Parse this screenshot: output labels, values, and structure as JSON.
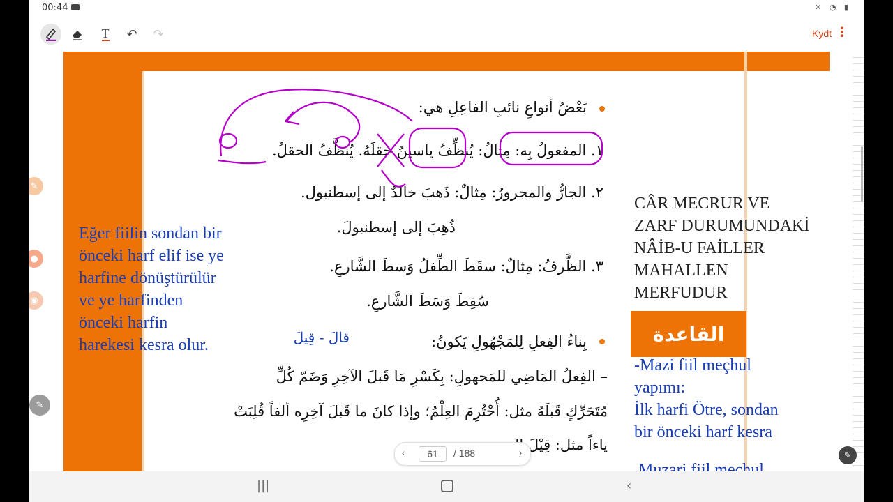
{
  "status": {
    "time": "00:44"
  },
  "toolbar": {
    "pen_icon": "pen-icon",
    "eraser_icon": "eraser-icon",
    "text_icon": "T",
    "undo_icon": "↶",
    "redo_icon": "↷",
    "save_label": "Kydt",
    "more_icon": "⋮"
  },
  "document": {
    "types_heading": "بَعْضُ أنواعِ نائبِ الفاعِلِ هي:",
    "item1": "١. المفعولُ بِه: مِثالٌ: يُنظِّفُ ياسينُ حقلَهُ. يُنظَّفُ الحقلُ.",
    "item2": "٢. الجارُّ والمجرورُ: مِثالٌ: ذَهبَ خالدٌ إلى إسطنبول.",
    "item2_passive": "ذُهِبَ إلى إسطنبولَ.",
    "item3": "٣. الظَّرفُ: مِثالٌ: سقَطَ الطِّفلُ وَسطَ الشَّارعِ.",
    "item3_passive": "سُقِطَ وَسَطَ الشَّارعِ.",
    "passive_heading": "بِناءُ الفِعلِ لِلمَجْهُولِ يَكونُ:",
    "passive_line1": "– الفِعلُ المَاضِي للمَجهولِ: بِكَسْرِ مَا قَبلَ الآخِرِ وَضَمّ كُلِّ",
    "passive_line2": "مُتَحَرِّكٍ قَبلَهُ مثل: أُحْتُرِمَ العِلْمُ؛ وإذا كانَ ما قَبلَ آخِرِه ألفاً قُلِبَتْ",
    "passive_line3": "ياءاً مثل: قِيْلَ الـ",
    "rule_banner": "القاعدة"
  },
  "annotations": {
    "left_note": [
      "Eğer fiilin sondan bir",
      "önceki harf elif ise  ye",
      "harfine dönüştürülür",
      "ve    ye    harfinden",
      "önceki       harfin",
      "harekesi  kesra  olur."
    ],
    "qala_qila": "قالَ  -  قِيلَ",
    "right_note_black": [
      "CÂR    MECRUR    VE",
      "ZARF DURUMUNDAKİ",
      "NÂİB-U     FAİLLER",
      "MAHALLEN",
      "MERFUDUR"
    ],
    "right_note_blue": [
      "-Mazi    fiil    meçhul",
      "yapımı:",
      "İlk harfi Ötre, sondan",
      "bir önceki harf kesra"
    ],
    "right_note_bottom": "Muzari   fiil   meçhul"
  },
  "pager": {
    "current": "61",
    "total": "/ 188"
  },
  "colors": {
    "orange": "#ee7306",
    "annotation_blue": "#1a3fb5",
    "ink_purple": "#b400c8",
    "accent": "#d9461a"
  }
}
